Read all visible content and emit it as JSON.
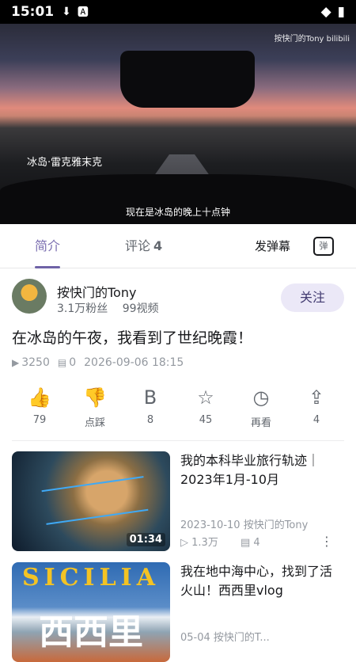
{
  "status": {
    "time": "15:01"
  },
  "video": {
    "location": "冰岛·雷克雅末克",
    "subtitle": "现在是冰岛的晚上十点钟",
    "watermark": "按快门的Tony bilibili"
  },
  "tabs": {
    "intro": "简介",
    "comment": "评论",
    "comment_count": "4",
    "danmaku_send": "发弹幕",
    "danmaku_toggle": "弹"
  },
  "uploader": {
    "name": "按快门的Tony",
    "fans": "3.1万粉丝",
    "videos": "99视频",
    "follow": "关注"
  },
  "video_title": "在冰岛的午夜，我看到了世纪晚霞！",
  "stats": {
    "plays": "3250",
    "danmaku": "0",
    "date": "2026-09-06 18:15"
  },
  "actions": [
    {
      "icon": "thumbs-up-icon",
      "label": "79"
    },
    {
      "icon": "thumbs-down-icon",
      "label": "点踩"
    },
    {
      "icon": "coin-icon",
      "label": "8"
    },
    {
      "icon": "star-icon",
      "label": "45"
    },
    {
      "icon": "clock-icon",
      "label": "再看"
    },
    {
      "icon": "share-icon",
      "label": "4"
    }
  ],
  "recommendations": [
    {
      "title": "我的本科毕业旅行轨迹｜2023年1月-10月",
      "duration": "01:34",
      "date": "2023-10-10",
      "author": "按快门的Tony",
      "views": "1.3万",
      "danmaku": "4"
    },
    {
      "title": "我在地中海中心，找到了活火山！西西里vlog",
      "thumb_text": "SICILIA",
      "thumb_cn": "西西里",
      "date": "05-04",
      "author": "按快门的T..."
    }
  ]
}
